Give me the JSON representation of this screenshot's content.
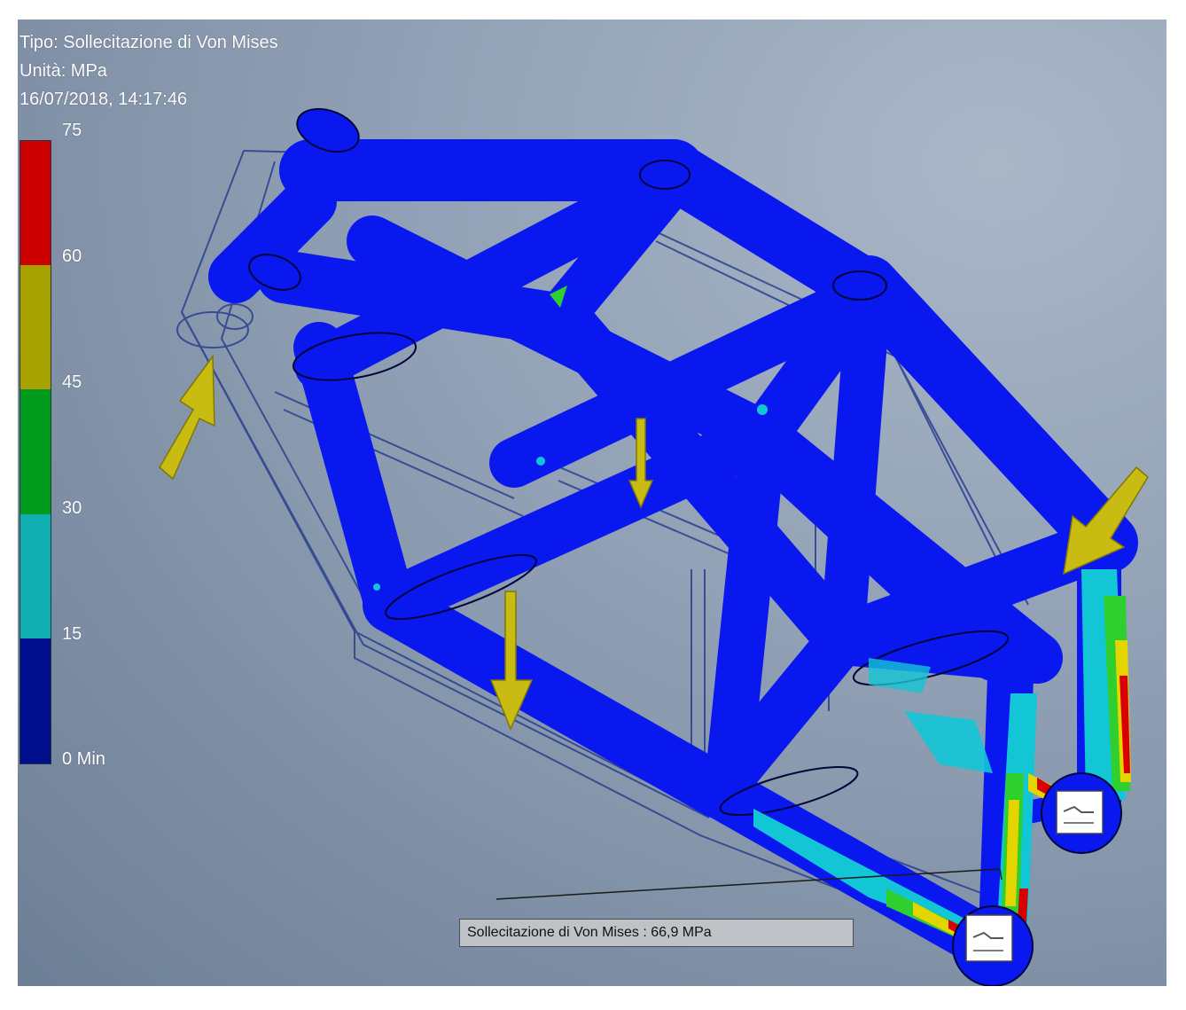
{
  "header": {
    "type_line": "Tipo: Sollecitazione di Von Mises",
    "unit_line": "Unità: MPa",
    "timestamp_line": "16/07/2018, 14:17:46"
  },
  "legend": {
    "ticks": [
      "75",
      "60",
      "45",
      "30",
      "15",
      "0 Min"
    ],
    "colors": [
      "#cc0000",
      "#a7a200",
      "#009a1c",
      "#10b0b0",
      "#000e8c"
    ]
  },
  "probe": {
    "label": "Sollecitazione di Von Mises : 66,9 MPa"
  },
  "model": {
    "base_color": "#0a18f0",
    "wireframe_color": "#1e3c9e",
    "load_arrow_color": "#c8bc12",
    "icons": [
      "load-arrow-icon",
      "fixed-constraint-icon"
    ]
  }
}
